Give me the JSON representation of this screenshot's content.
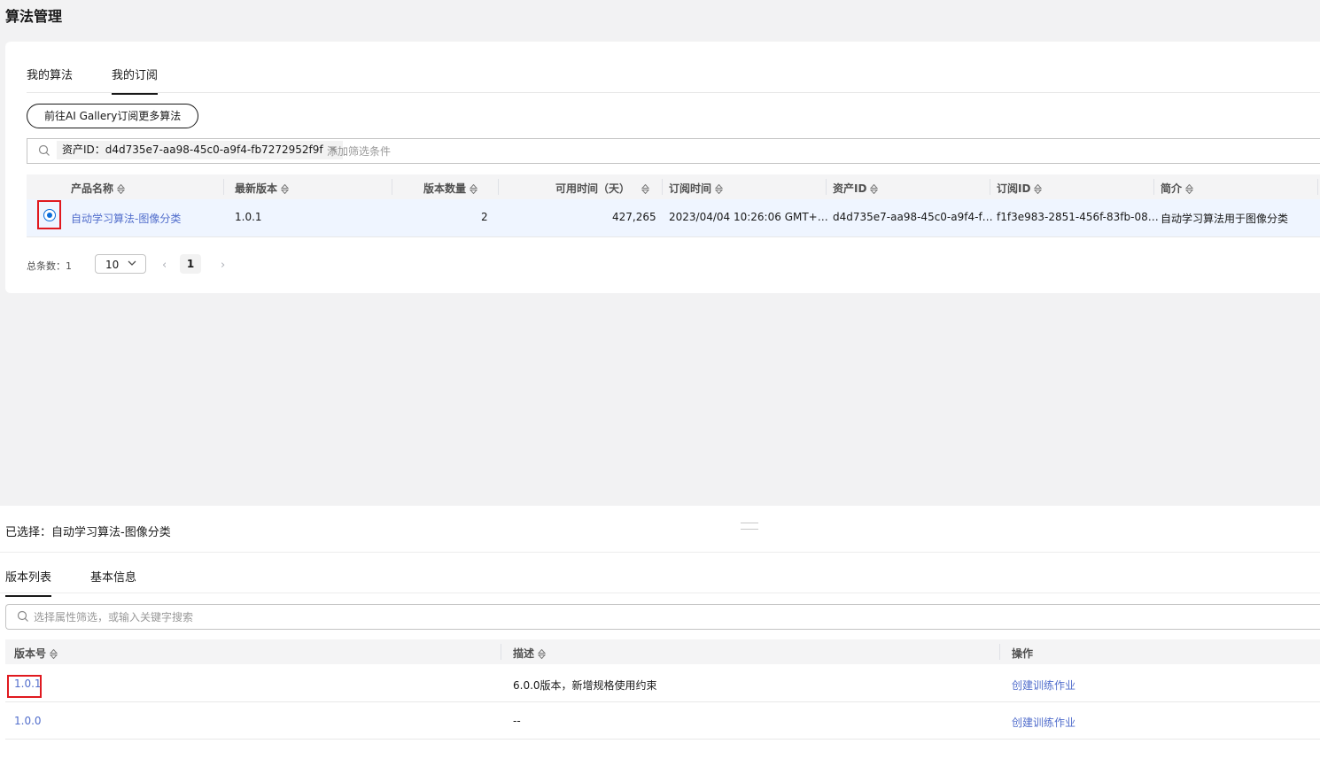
{
  "page": {
    "title": "算法管理"
  },
  "tabs": [
    "我的算法",
    "我的订阅"
  ],
  "gallery_button": "前往AI Gallery订阅更多算法",
  "filter": {
    "chip": "资产ID：d4d735e7-aa98-45c0-a9f4-fb7272952f9f",
    "placeholder": "添加筛选条件"
  },
  "table": {
    "headers": [
      "产品名称",
      "最新版本",
      "版本数量",
      "可用时间（天）",
      "订阅时间",
      "资产ID",
      "订阅ID",
      "简介"
    ],
    "row": {
      "name": "自动学习算法-图像分类",
      "latest_version": "1.0.1",
      "version_count": "2",
      "available_days": "427,265",
      "subscribe_time": "2023/04/04 10:26:06 GMT+…",
      "asset_id": "d4d735e7-aa98-45c0-a9f4-f…",
      "subscription_id": "f1f3e983-2851-456f-83fb-08…",
      "intro": "自动学习算法用于图像分类"
    }
  },
  "pager": {
    "total": "总条数：1",
    "page_size": "10",
    "current": "1"
  },
  "detail": {
    "selected": "已选择：自动学习算法-图像分类",
    "tabs": [
      "版本列表",
      "基本信息"
    ],
    "search_placeholder": "选择属性筛选，或输入关键字搜索",
    "headers": [
      "版本号",
      "描述",
      "操作"
    ],
    "rows": [
      {
        "version": "1.0.1",
        "desc": "6.0.0版本，新增规格使用约束",
        "action": "创建训练作业"
      },
      {
        "version": "1.0.0",
        "desc": "--",
        "action": "创建训练作业"
      }
    ]
  },
  "colors": {
    "link": "#526ecc",
    "radio": "#0a6cd9",
    "highlight": "#e0191f"
  }
}
